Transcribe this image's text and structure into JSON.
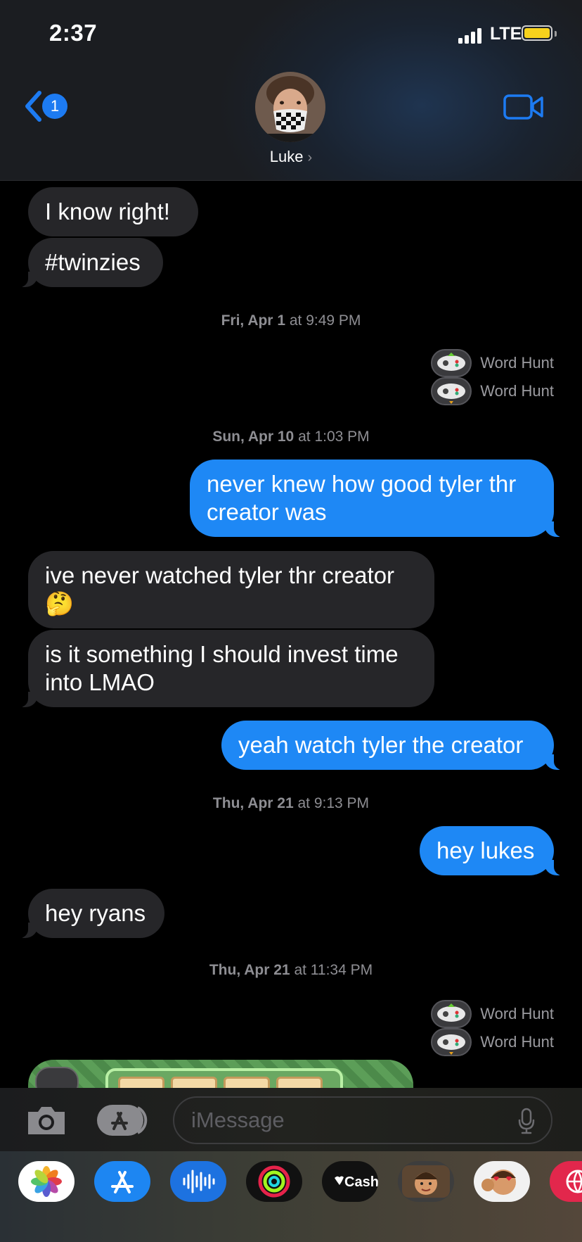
{
  "status": {
    "time": "2:37",
    "network": "LTE"
  },
  "header": {
    "unread_count": "1",
    "contact_name": "Luke",
    "contact_chevron": "›"
  },
  "messages": {
    "m1": "I know right!",
    "m2": "#twinzies",
    "ts1": {
      "date": "Fri, Apr 1",
      "time": "at 9:49 PM"
    },
    "game1": "Word Hunt",
    "game2": "Word Hunt",
    "ts2": {
      "date": "Sun, Apr 10",
      "time": "at 1:03 PM"
    },
    "m3": "never knew how good tyler thr creator was",
    "m4": "ive never watched tyler thr creator 🤔",
    "m5": "is it something I should invest time into LMAO",
    "m6": "yeah watch tyler the creator",
    "ts3": {
      "date": "Thu, Apr 21",
      "time": "at 9:13 PM"
    },
    "m7": "hey lukes",
    "m8": "hey ryans",
    "ts4": {
      "date": "Thu, Apr 21",
      "time": "at 11:34 PM"
    },
    "game3": "Word Hunt",
    "game4": "Word Hunt"
  },
  "input": {
    "placeholder": "iMessage"
  },
  "drawer": {
    "apps": [
      "photos-app",
      "app-store-app",
      "audio-message-app",
      "activity-app",
      "apple-cash-app",
      "memoji-app",
      "memoji-stickers-app",
      "web-search-app"
    ],
    "cash_label": "Cash"
  },
  "colors": {
    "sent_bubble": "#1e88f5",
    "received_bubble": "#262629",
    "accent": "#1d7bf2",
    "battery": "#f7d21c"
  }
}
